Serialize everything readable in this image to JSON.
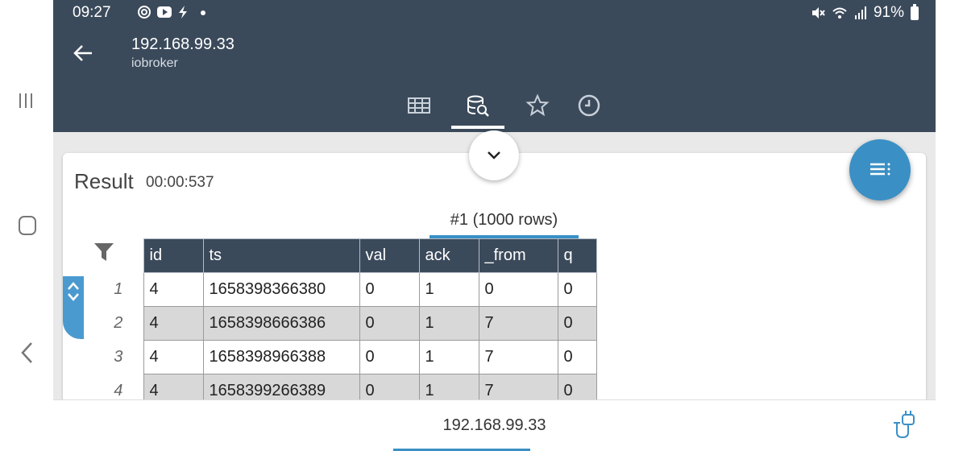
{
  "status": {
    "time": "09:27",
    "battery": "91%"
  },
  "header": {
    "title": "192.168.99.33",
    "subtitle": "iobroker"
  },
  "tabs": [
    {
      "icon": "table-icon",
      "active": false
    },
    {
      "icon": "database-search-icon",
      "active": true
    },
    {
      "icon": "star-icon",
      "active": false
    },
    {
      "icon": "clock-icon",
      "active": false
    }
  ],
  "result": {
    "label": "Result",
    "time": "00:00:537",
    "tab_label": "#1 (1000 rows)"
  },
  "table": {
    "columns": [
      "id",
      "ts",
      "val",
      "ack",
      "_from",
      "q"
    ],
    "rows": [
      {
        "n": "1",
        "cells": [
          "4",
          "1658398366380",
          "0",
          "1",
          "0",
          "0"
        ]
      },
      {
        "n": "2",
        "cells": [
          "4",
          "1658398666386",
          "0",
          "1",
          "7",
          "0"
        ]
      },
      {
        "n": "3",
        "cells": [
          "4",
          "1658398966388",
          "0",
          "1",
          "7",
          "0"
        ]
      },
      {
        "n": "4",
        "cells": [
          "4",
          "1658399266389",
          "0",
          "1",
          "7",
          "0"
        ]
      }
    ]
  },
  "bottom": {
    "title": "192.168.99.33"
  },
  "colors": {
    "header": "#3b4a5b",
    "accent": "#3a90c5",
    "alt_row": "#d8d8d8"
  }
}
